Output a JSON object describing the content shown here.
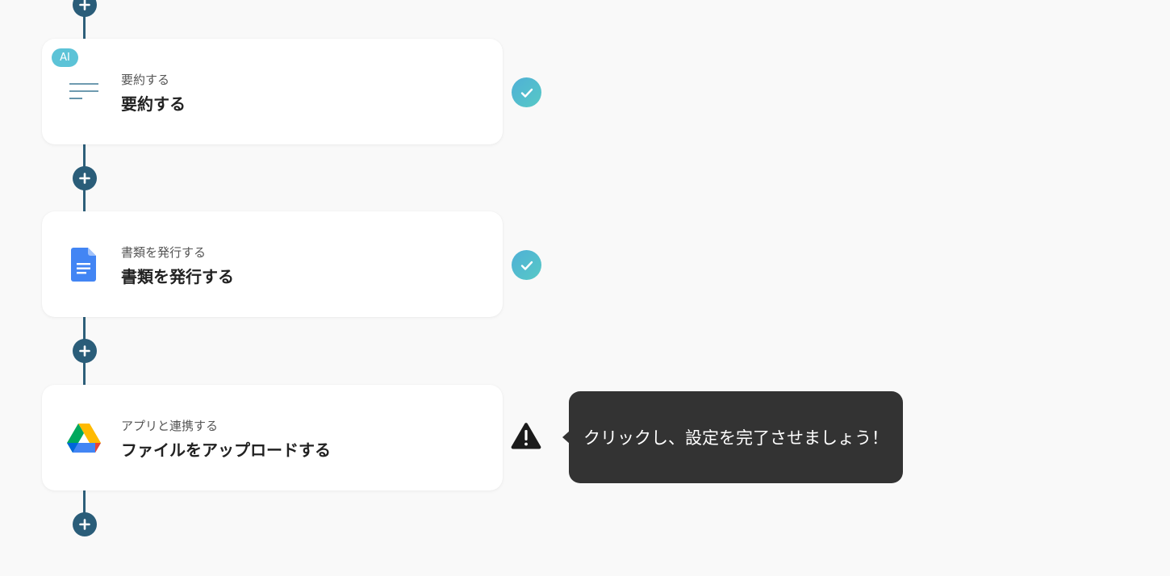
{
  "steps": [
    {
      "badge": "AI",
      "icon": "summary-lines-icon",
      "subtitle": "要約する",
      "title": "要約する",
      "status": "complete"
    },
    {
      "icon": "google-docs-icon",
      "subtitle": "書類を発行する",
      "title": "書類を発行する",
      "status": "complete"
    },
    {
      "icon": "google-drive-icon",
      "subtitle": "アプリと連携する",
      "title": "ファイルをアップロードする",
      "status": "warning"
    }
  ],
  "tooltip": {
    "text": "クリックし、設定を完了させましょう！"
  },
  "colors": {
    "connector": "#2d5f7a",
    "ai_badge": "#5cc3d7",
    "check": "#4fb0d6",
    "tooltip_bg": "#333333"
  }
}
